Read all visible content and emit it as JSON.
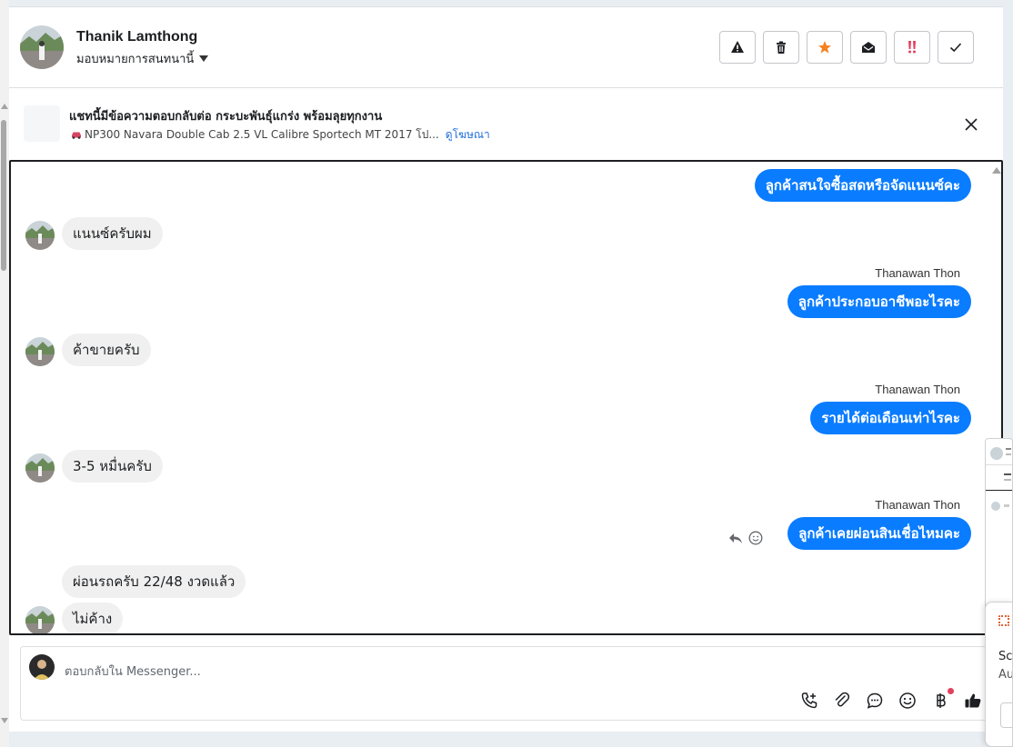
{
  "header": {
    "contact_name": "Thanik Lamthong",
    "assign_label": "มอบหมายการสนทนานี้",
    "actions": [
      "warning-icon",
      "trash-icon",
      "star-icon",
      "mark-read-icon",
      "important-icon",
      "check-icon"
    ]
  },
  "banner": {
    "title": "แชทนี้มีข้อความตอบกลับต่อ กระบะพันธุ์แกร่ง พร้อมลุยทุกงาน",
    "subtitle": "NP300 Navara Double Cab 2.5 VL Calibre Sportech MT 2017 โป...",
    "link": "ดูโฆษณา"
  },
  "messages": [
    {
      "dir": "out",
      "text": "ลูกค้าสนใจซื้อสดหรือจัดแนนซ์คะ"
    },
    {
      "dir": "in",
      "text": "แนนซ์ครับผม"
    },
    {
      "dir": "out",
      "sender": "Thanawan Thon",
      "text": "ลูกค้าประกอบอาชีพอะไรคะ"
    },
    {
      "dir": "in",
      "text": "ค้าขายครับ"
    },
    {
      "dir": "out",
      "sender": "Thanawan Thon",
      "text": "รายได้ต่อเดือนเท่าไรคะ"
    },
    {
      "dir": "in",
      "text": "3-5 หมื่นครับ"
    },
    {
      "dir": "out",
      "sender": "Thanawan Thon",
      "text": "ลูกค้าเคยผ่อนสินเชื่อไหมคะ"
    },
    {
      "dir": "in",
      "text": "ผ่อนรถครับ 22/48 งวดแล้ว"
    },
    {
      "dir": "in",
      "text": "ไม่ค้าง"
    }
  ],
  "composer": {
    "placeholder": "ตอบกลับใน Messenger..."
  },
  "peek": {
    "line1": "Scr",
    "line2": "Au"
  },
  "colors": {
    "outgoing_bubble": "#0a7cff",
    "incoming_bubble": "#f0f0f0",
    "link": "#216fdb",
    "star": "#f5821f",
    "important": "#e4405f"
  }
}
